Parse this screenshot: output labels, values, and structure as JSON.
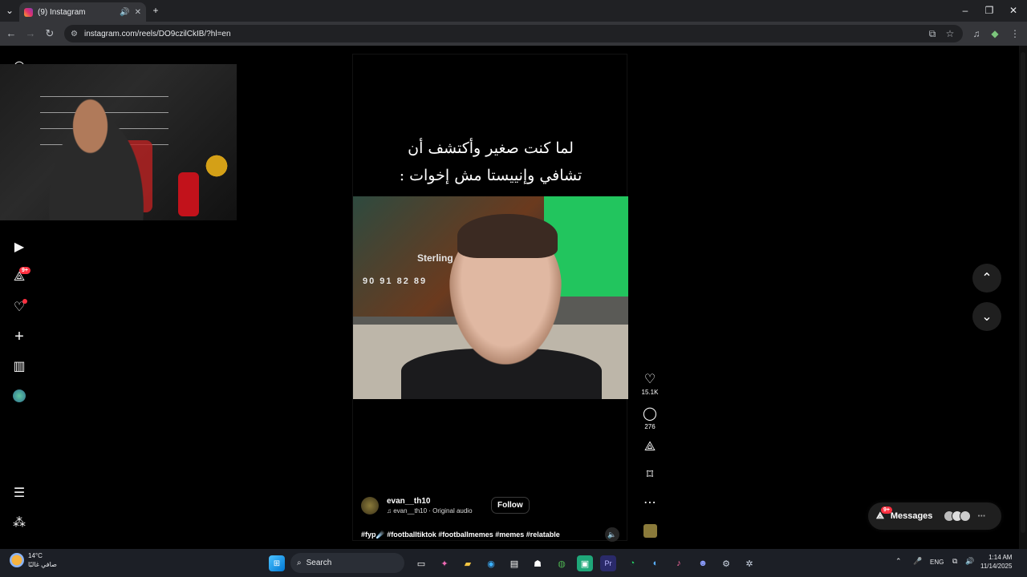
{
  "browser": {
    "tab_title": "(9) Instagram",
    "url": "instagram.com/reels/DO9czilCkIB/?hl=en",
    "colors": {
      "tabstrip": "#202124",
      "toolbar": "#35363a",
      "omnibox": "#202124"
    }
  },
  "sidebar": {
    "items": [
      {
        "icon": "instagram-logo-icon"
      },
      {
        "icon": "reels-icon"
      },
      {
        "icon": "messages-icon",
        "badge": "9+"
      },
      {
        "icon": "notifications-heart-icon"
      },
      {
        "icon": "create-plus-icon"
      },
      {
        "icon": "dashboard-icon"
      },
      {
        "icon": "profile-avatar-icon"
      },
      {
        "icon": "more-menu-icon"
      },
      {
        "icon": "also-from-meta-icon"
      }
    ]
  },
  "reel": {
    "caption": "لما كنت صغير وأكتشف أن تشافي وإنييستا مش إخوات :",
    "video_text": {
      "jersey_name": "Sterling",
      "stats": "90 91 82 89"
    },
    "username": "evan__th10",
    "audio": "evan__th10 · Original audio",
    "follow_label": "Follow",
    "hashtags": "#fyp☄️ #footballtiktok #footballmemes #memes #relatable",
    "likes": "15.1K",
    "comments": "276"
  },
  "messages": {
    "label": "Messages",
    "badge": "9+"
  },
  "taskbar": {
    "weather_temp": "14°C",
    "weather_desc": "صافي غالبًا",
    "search_label": "Search",
    "language": "ENG",
    "time": "1:14 AM",
    "date": "11/14/2025"
  }
}
